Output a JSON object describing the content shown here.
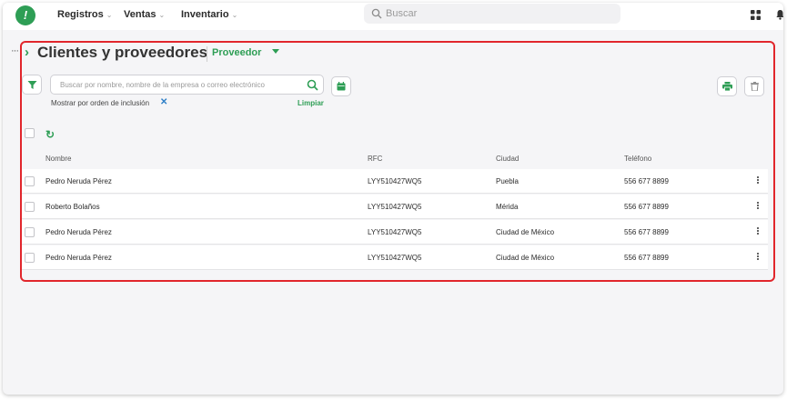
{
  "nav": {
    "menu": [
      {
        "label": "Registros"
      },
      {
        "label": "Ventas"
      },
      {
        "label": "Inventario"
      }
    ],
    "search_placeholder": "Buscar"
  },
  "page": {
    "title": "Clientes y proveedores",
    "type_selector": "Proveedor"
  },
  "filters": {
    "search_placeholder": "Buscar por nombre, nombre de la empresa o correo electrónico",
    "order_label": "Mostrar por orden de inclusión",
    "clear_label": "Limpiar"
  },
  "table": {
    "columns": [
      "Nombre",
      "RFC",
      "Ciudad",
      "Teléfono"
    ],
    "rows": [
      {
        "nombre": "Pedro Neruda Pérez",
        "rfc": "LYY510427WQ5",
        "ciudad": "Puebla",
        "telefono": "556 677 8899"
      },
      {
        "nombre": "Roberto Bolaños",
        "rfc": "LYY510427WQ5",
        "ciudad": "Mérida",
        "telefono": "556 677 8899"
      },
      {
        "nombre": "Pedro Neruda Pérez",
        "rfc": "LYY510427WQ5",
        "ciudad": "Ciudad de México",
        "telefono": "556 677 8899"
      },
      {
        "nombre": "Pedro Neruda Pérez",
        "rfc": "LYY510427WQ5",
        "ciudad": "Ciudad de México",
        "telefono": "556 677 8899"
      }
    ]
  },
  "colors": {
    "accent": "#2e9e55",
    "highlight": "#e1262c",
    "link": "#2e7fc7"
  }
}
